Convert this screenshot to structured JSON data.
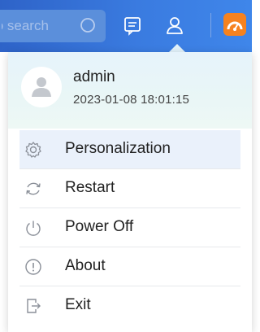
{
  "topbar": {
    "search_placeholder": "to search",
    "icons": [
      "search-icon",
      "message-icon",
      "user-icon",
      "dashboard-icon"
    ]
  },
  "user": {
    "name": "admin",
    "login_time": "2023-01-08 18:01:15"
  },
  "menu": [
    {
      "label": "Personalization",
      "icon": "gear-icon",
      "active": true
    },
    {
      "label": "Restart",
      "icon": "restart-icon"
    },
    {
      "label": "Power Off",
      "icon": "power-icon"
    },
    {
      "label": "About",
      "icon": "info-icon"
    },
    {
      "label": "Exit",
      "icon": "exit-icon"
    }
  ],
  "colors": {
    "topbar": "#3a7be0",
    "accent_orange": "#f6821f",
    "active_row": "#eaf1fb",
    "icon_gray": "#8a8f98"
  }
}
